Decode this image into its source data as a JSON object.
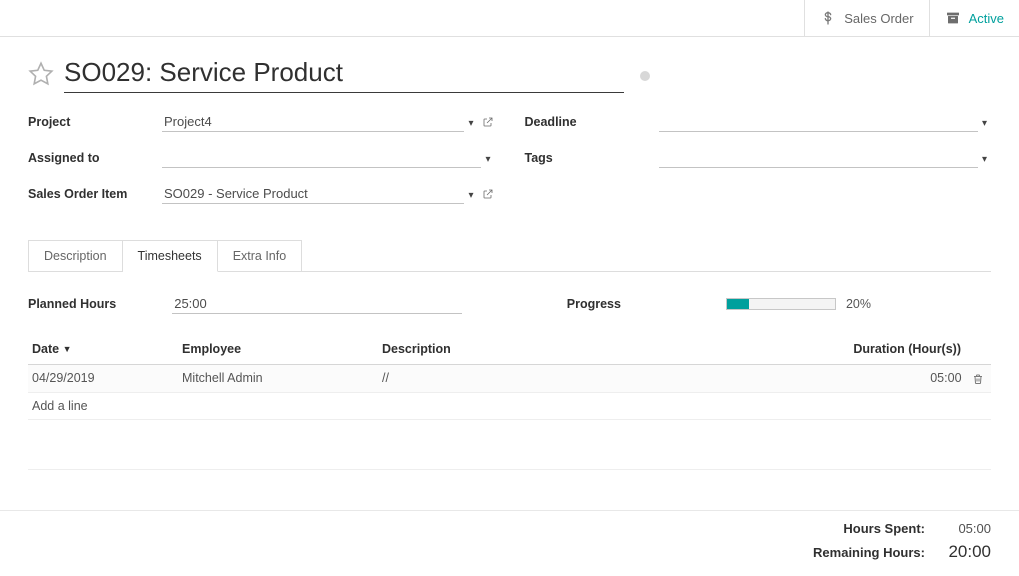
{
  "topbar": {
    "sales_order_label": "Sales Order",
    "active_label": "Active"
  },
  "header": {
    "title": "SO029: Service Product"
  },
  "form": {
    "project_label": "Project",
    "project_value": "Project4",
    "assigned_label": "Assigned to",
    "assigned_value": "",
    "soitem_label": "Sales Order Item",
    "soitem_value": "SO029 - Service Product",
    "deadline_label": "Deadline",
    "deadline_value": "",
    "tags_label": "Tags",
    "tags_value": ""
  },
  "tabs": {
    "description": "Description",
    "timesheets": "Timesheets",
    "extra": "Extra Info"
  },
  "timesheet": {
    "planned_label": "Planned Hours",
    "planned_value": "25:00",
    "progress_label": "Progress",
    "progress_pct_text": "20%",
    "progress_pct_num": 20,
    "columns": {
      "date": "Date",
      "employee": "Employee",
      "description": "Description",
      "duration": "Duration (Hour(s))"
    },
    "rows": [
      {
        "date": "04/29/2019",
        "employee": "Mitchell Admin",
        "description": "//",
        "duration": "05:00"
      }
    ],
    "add_line": "Add a line"
  },
  "totals": {
    "spent_label": "Hours Spent:",
    "spent_value": "05:00",
    "remaining_label": "Remaining Hours:",
    "remaining_value": "20:00"
  }
}
